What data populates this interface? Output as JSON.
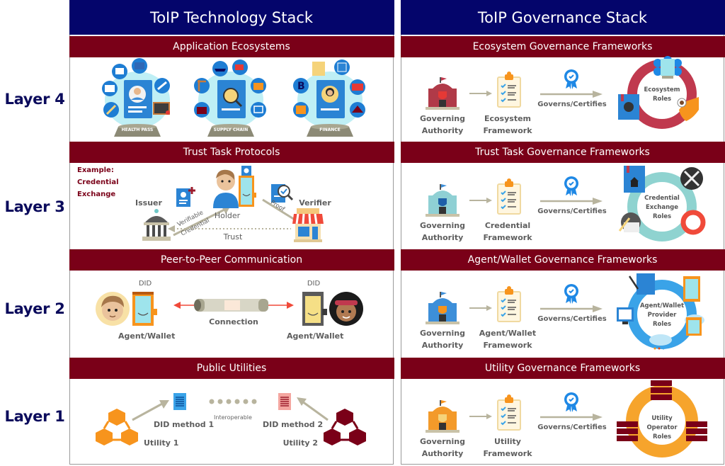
{
  "layers": [
    {
      "label": "Layer 4"
    },
    {
      "label": "Layer 3"
    },
    {
      "label": "Layer 2"
    },
    {
      "label": "Layer 1"
    }
  ],
  "technology_stack": {
    "title": "ToIP Technology Stack",
    "layer4": {
      "band": "Application Ecosystems",
      "ecosystems": [
        {
          "label": "HEALTH PASS",
          "icon": "health-pass-globe-icon"
        },
        {
          "label": "SUPPLY CHAIN",
          "icon": "supply-chain-globe-icon"
        },
        {
          "label": "FINANCE",
          "icon": "finance-globe-icon"
        }
      ]
    },
    "layer3": {
      "band": "Trust Task Protocols",
      "example_label": [
        "Example:",
        "Credential",
        "Exchange"
      ],
      "issuer": "Issuer",
      "holder": "Holder",
      "verifier": "Verifier",
      "credential_arrow": [
        "Verifiable",
        "Credential"
      ],
      "proof_arrow": "Proof",
      "trust_arrow": "Trust"
    },
    "layer2": {
      "band": "Peer-to-Peer Communication",
      "did_left": "DID",
      "did_right": "DID",
      "agent_left": "Agent/Wallet",
      "agent_right": "Agent/Wallet",
      "connection": "Connection"
    },
    "layer1": {
      "band": "Public Utilities",
      "did_method_1": "DID method 1",
      "did_method_2": "DID method 2",
      "interoperable": "Interoperable",
      "utility_1": "Utility 1",
      "utility_2": "Utility 2"
    }
  },
  "governance_stack": {
    "title": "ToIP Governance Stack",
    "rows": [
      {
        "band": "Ecosystem Governance Frameworks",
        "authority": [
          "Governing",
          "Authority"
        ],
        "framework": [
          "Ecosystem",
          "Framework"
        ],
        "arrow": "Governs/Certifies",
        "roles": [
          "Ecosystem",
          "Roles"
        ],
        "authority_color": "#b03a48",
        "ring_color": "#c0394e"
      },
      {
        "band": "Trust Task Governance Frameworks",
        "authority": [
          "Governing",
          "Authority"
        ],
        "framework": [
          "Credential",
          "Framework"
        ],
        "arrow": "Governs/Certifies",
        "roles": [
          "Credential",
          "Exchange",
          "Roles"
        ],
        "authority_color": "#8fd0d4",
        "ring_color": "#8fd3d0"
      },
      {
        "band": "Agent/Wallet Governance Frameworks",
        "authority": [
          "Governing",
          "Authority"
        ],
        "framework": [
          "Agent/Wallet",
          "Framework"
        ],
        "arrow": "Governs/Certifies",
        "roles": [
          "Agent/Wallet",
          "Provider",
          "Roles"
        ],
        "authority_color": "#3d8fd9",
        "ring_color": "#3aa3e8"
      },
      {
        "band": "Utility Governance Frameworks",
        "authority": [
          "Governing",
          "Authority"
        ],
        "framework": [
          "Utility",
          "Framework"
        ],
        "arrow": "Governs/Certifies",
        "roles": [
          "Utility",
          "Operator",
          "Roles"
        ],
        "authority_color": "#f39a2a",
        "ring_color": "#f6a42c"
      }
    ]
  },
  "colors": {
    "title_bar": "#04056b",
    "band": "#7a0018",
    "layer_label": "#0b0b5c",
    "arrow_grey": "#b8b49e",
    "badge_blue": "#1e88e5",
    "accent_orange": "#f7941d",
    "accent_red": "#e64a19"
  }
}
